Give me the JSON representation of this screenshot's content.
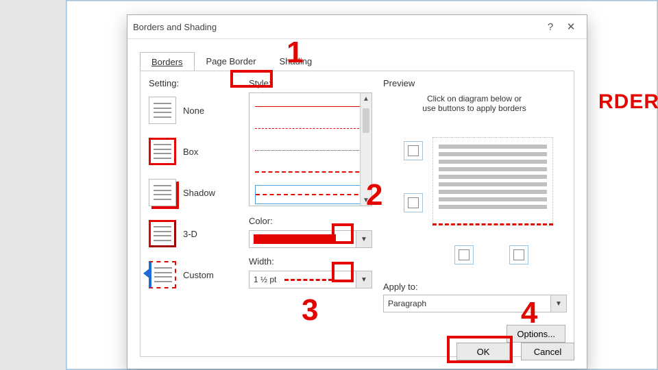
{
  "dialog": {
    "title": "Borders and Shading",
    "help_glyph": "?",
    "close_glyph": "✕"
  },
  "tabs": {
    "borders": "Borders",
    "page_border": "Page Border",
    "shading": "Shading"
  },
  "setting": {
    "label": "Setting:",
    "none": "None",
    "box": "Box",
    "shadow": "Shadow",
    "threed": "3-D",
    "custom": "Custom"
  },
  "style": {
    "label": "Style:",
    "color_label": "Color:",
    "color_value": "#e30600",
    "width_label": "Width:",
    "width_value": "1 ½ pt"
  },
  "preview": {
    "label": "Preview",
    "hint_line1": "Click on diagram below or",
    "hint_line2": "use buttons to apply borders",
    "apply_label": "Apply to:",
    "apply_value": "Paragraph",
    "options": "Options..."
  },
  "footer": {
    "ok": "OK",
    "cancel": "Cancel"
  },
  "annotations": {
    "n1": "1",
    "n2": "2",
    "n3": "3",
    "n4": "4",
    "side": "RDER"
  }
}
